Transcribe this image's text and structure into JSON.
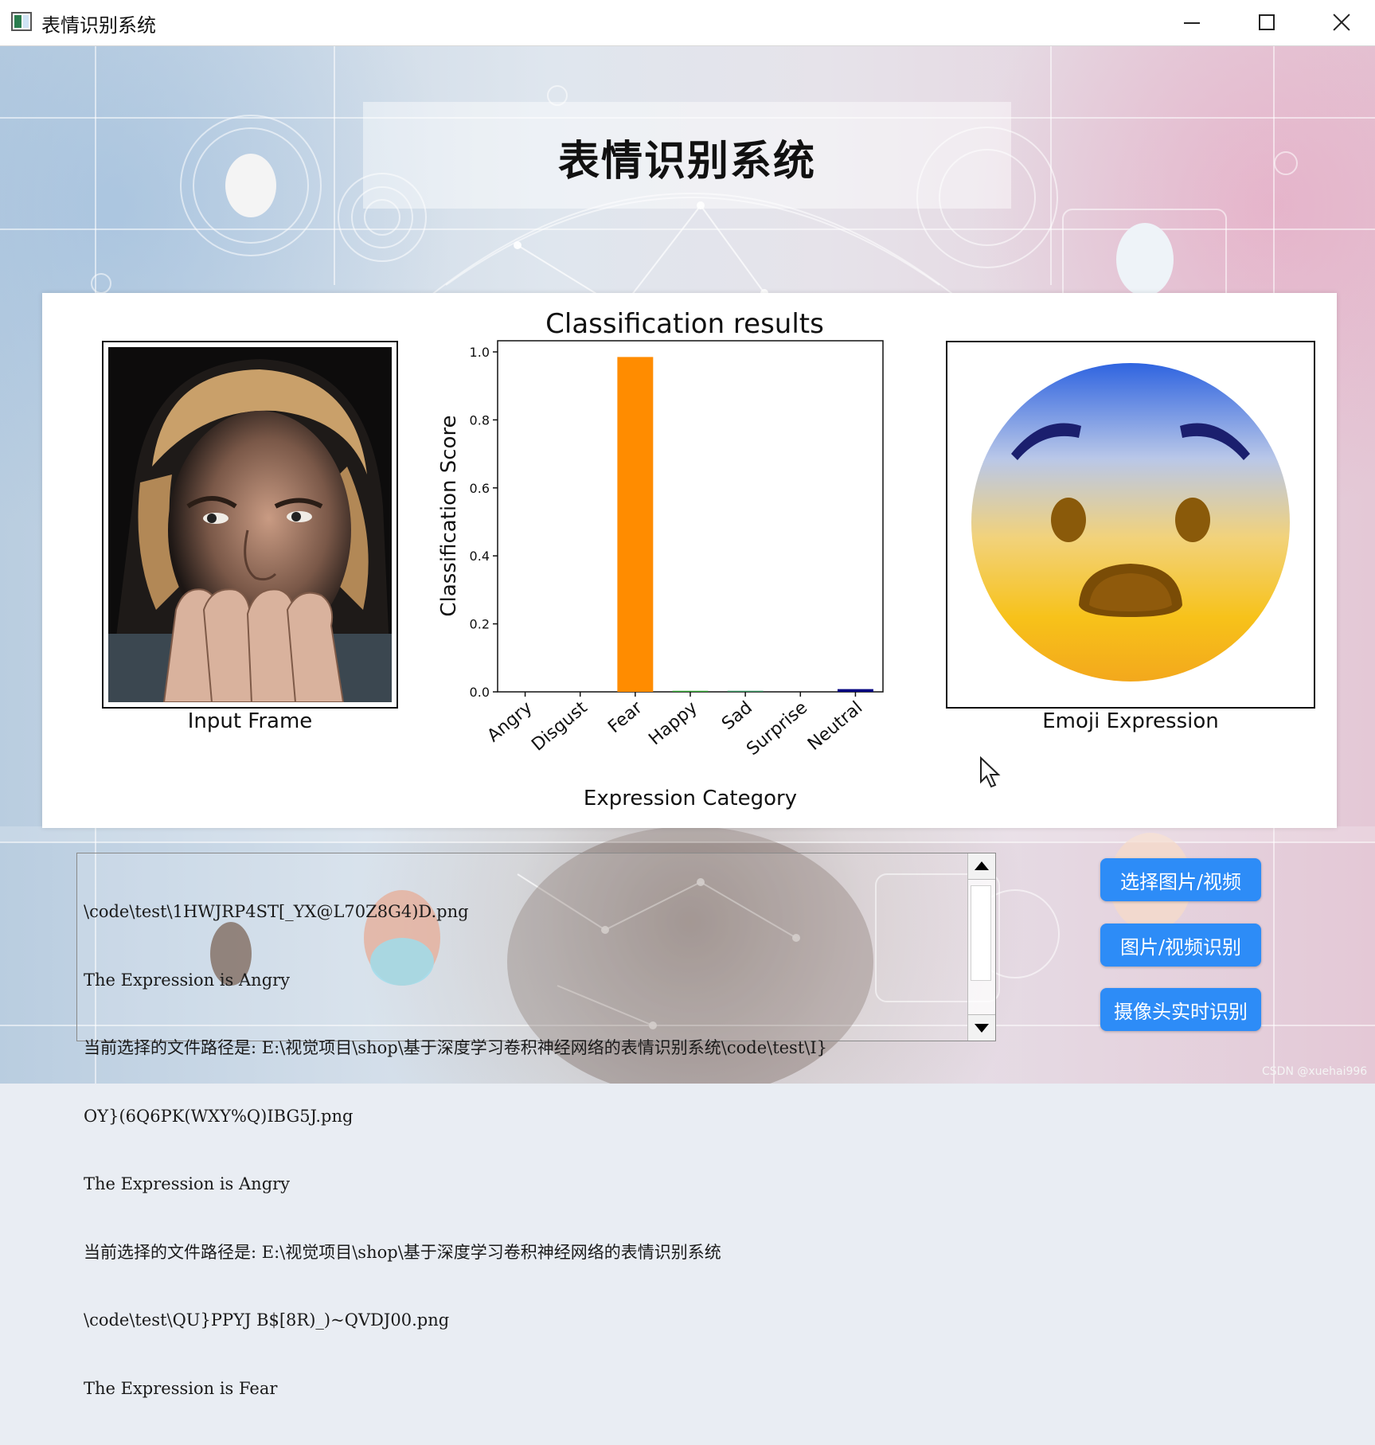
{
  "window": {
    "title": "表情识别系统",
    "icon": "app-window-icon",
    "controls": [
      "minimize-icon",
      "maximize-icon",
      "close-icon"
    ]
  },
  "page_title": "表情识别系统",
  "panels": {
    "input_frame_label": "Input Frame",
    "emoji_label": "Emoji Expression",
    "emoji_icon": "fearful-face-emoji"
  },
  "chart_data": {
    "type": "bar",
    "title": "Classification results",
    "xlabel": "Expression Category",
    "ylabel": "Classification Score",
    "categories": [
      "Angry",
      "Disgust",
      "Fear",
      "Happy",
      "Sad",
      "Surprise",
      "Neutral"
    ],
    "values": [
      0.0,
      0.0,
      0.985,
      0.003,
      0.003,
      0.0,
      0.008
    ],
    "colors": [
      "#d62728",
      "#8c564b",
      "#ff8c00",
      "#2ca02c",
      "#2e8b57",
      "#9aa0a6",
      "#000080"
    ],
    "ylim": [
      0,
      1.0
    ],
    "yticks": [
      "0.0",
      "0.2",
      "0.4",
      "0.6",
      "0.8",
      "1.0"
    ],
    "grid": false
  },
  "log": {
    "lines": [
      "\\code\\test\\1HWJRP4ST[_YX@L70Z8G4)D.png",
      "The Expression is Angry",
      "当前选择的文件路径是: E:\\视觉项目\\shop\\基于深度学习卷积神经网络的表情识别系统\\code\\test\\I}",
      "OY}(6Q6PK(WXY%Q)IBG5J.png",
      "The Expression is Angry",
      "当前选择的文件路径是: E:\\视觉项目\\shop\\基于深度学习卷积神经网络的表情识别系统",
      "\\code\\test\\QU}PPYJ B$[8R)_)~QVDJ00.png",
      "The Expression is Fear"
    ]
  },
  "buttons": {
    "select": "选择图片/视频",
    "recognize": "图片/视频识别",
    "camera": "摄像头实时识别"
  },
  "watermark": "CSDN @xuehai996"
}
